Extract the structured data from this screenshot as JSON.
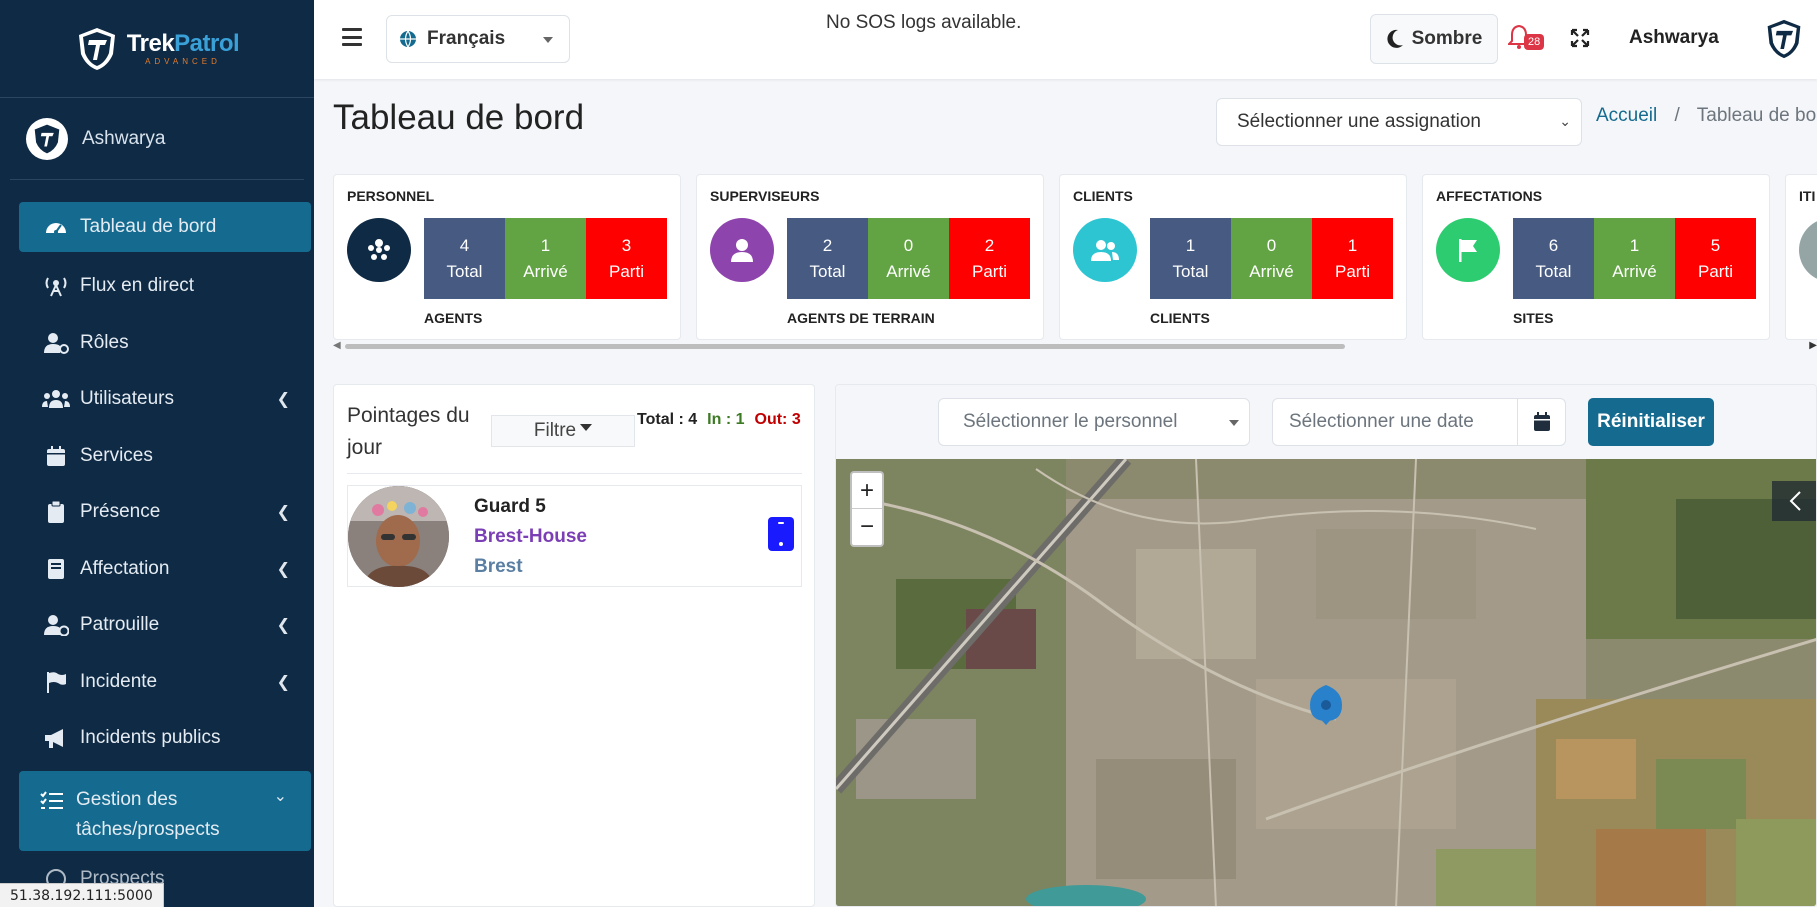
{
  "brand": {
    "name_part1": "Trek",
    "name_part2": "Patrol",
    "subtitle": "ADVANCED"
  },
  "sidebar": {
    "user_name": "Ashwarya",
    "items": [
      {
        "label": "Tableau de bord",
        "icon": "dashboard-icon"
      },
      {
        "label": "Flux en direct",
        "icon": "broadcast-icon"
      },
      {
        "label": "Rôles",
        "icon": "user-cog-icon"
      },
      {
        "label": "Utilisateurs",
        "icon": "users-icon"
      },
      {
        "label": "Services",
        "icon": "calendar-icon"
      },
      {
        "label": "Présence",
        "icon": "clipboard-icon"
      },
      {
        "label": "Affectation",
        "icon": "book-icon"
      },
      {
        "label": "Patrouille",
        "icon": "user-clock-icon"
      },
      {
        "label": "Incidente",
        "icon": "flag-icon"
      },
      {
        "label": "Incidents publics",
        "icon": "megaphone-icon"
      },
      {
        "label": "Gestion des tâches/prospects",
        "icon": "tasks-icon"
      },
      {
        "label": "Prospects",
        "icon": "circle-icon"
      }
    ],
    "status_url": "51.38.192.111:5000"
  },
  "topbar": {
    "language": "Français",
    "sos_message": "No SOS logs available.",
    "theme_label": "Sombre",
    "notification_count": "28",
    "user_name": "Ashwarya"
  },
  "page": {
    "title": "Tableau de bord",
    "assignment_placeholder": "Sélectionner une assignation",
    "breadcrumb_home": "Accueil",
    "breadcrumb_current": "Tableau de bord"
  },
  "stats": [
    {
      "title": "PERSONNEL",
      "total": "4",
      "arrived": "1",
      "departed": "3",
      "footer": "AGENTS",
      "color": "#0f2a44"
    },
    {
      "title": "SUPERVISEURS",
      "total": "2",
      "arrived": "0",
      "departed": "2",
      "footer": "AGENTS DE TERRAIN",
      "color": "#8e44ad"
    },
    {
      "title": "CLIENTS",
      "total": "1",
      "arrived": "0",
      "departed": "1",
      "footer": "CLIENTS",
      "color": "#2ec5d3"
    },
    {
      "title": "AFFECTATIONS",
      "total": "6",
      "arrived": "1",
      "departed": "5",
      "footer": "SITES",
      "color": "#2ecc71"
    },
    {
      "title": "ITI",
      "color": "#95a5a6"
    }
  ],
  "stat_labels": {
    "total": "Total",
    "arrived": "Arrivé",
    "departed": "Parti"
  },
  "checkins": {
    "title": "Pointages du jour",
    "filter_label": "Filtre",
    "total_label": "Total : 4",
    "in_label": "In : 1",
    "out_label": "Out: 3",
    "guard": {
      "name": "Guard 5",
      "site": "Brest-House",
      "city": "Brest"
    }
  },
  "map_controls": {
    "personnel_placeholder": "Sélectionner le personnel",
    "date_placeholder": "Sélectionner une date",
    "reset_label": "Réinitialiser",
    "zoom_in": "+",
    "zoom_out": "−"
  }
}
